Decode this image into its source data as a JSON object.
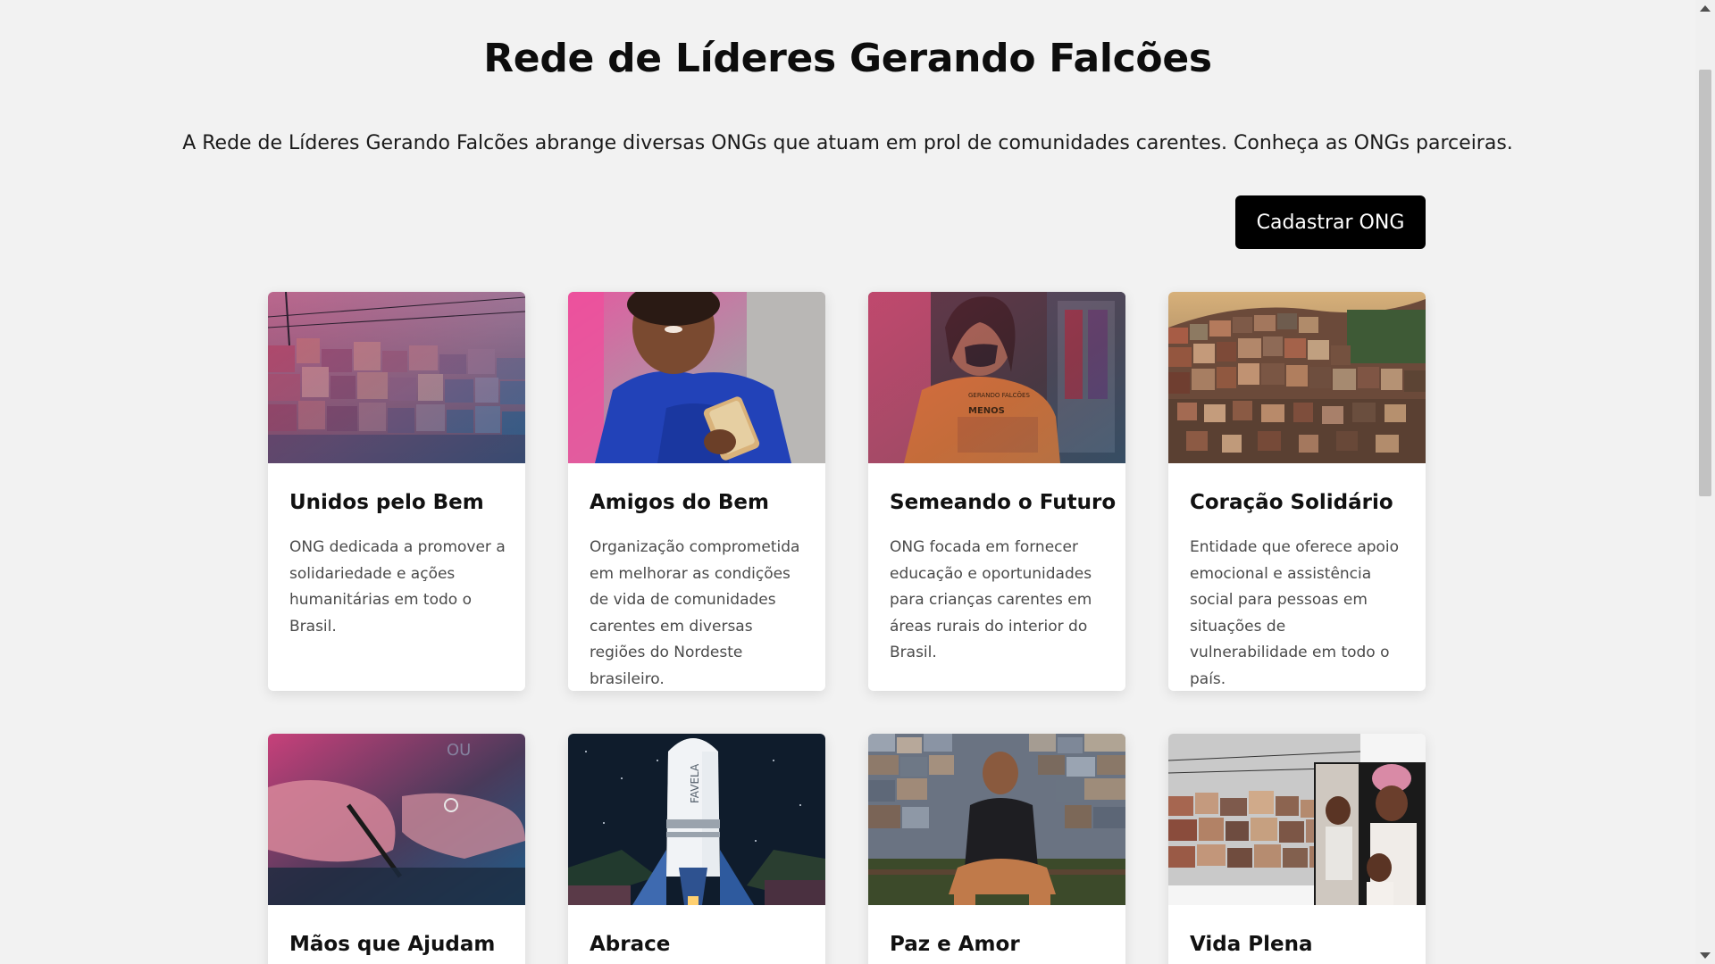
{
  "header": {
    "title": "Rede de Líderes Gerando Falcões",
    "intro": "A Rede de Líderes Gerando Falcões abrange diversas ONGs que atuam em prol de comunidades carentes. Conheça as ONGs parceiras.",
    "cta_label": "Cadastrar ONG"
  },
  "cards": [
    {
      "title": "Unidos pelo Bem",
      "description": "ONG dedicada a promover a solidariedade e ações humanitárias em todo o Brasil."
    },
    {
      "title": "Amigos do Bem",
      "description": "Organização comprometida em melhorar as condições de vida de comunidades carentes em diversas regiões do Nordeste brasileiro."
    },
    {
      "title": "Semeando o Futuro",
      "description": "ONG focada em fornecer educação e oportunidades para crianças carentes em áreas rurais do interior do Brasil."
    },
    {
      "title": "Coração Solidário",
      "description": "Entidade que oferece apoio emocional e assistência social para pessoas em situações de vulnerabilidade em todo o país."
    },
    {
      "title": "Mãos que Ajudam",
      "description": ""
    },
    {
      "title": "Abrace",
      "description": ""
    },
    {
      "title": "Paz e Amor",
      "description": ""
    },
    {
      "title": "Vida Plena",
      "description": ""
    }
  ],
  "images": {
    "logo_text_orange_shirt": "GERANDO FALCÕES",
    "shirt_word": "MENOS",
    "rocket_text": "FAVELA",
    "sign_text": "OU"
  },
  "colors": {
    "background": "#f2f2f2",
    "button": "#000000",
    "button_text": "#ffffff",
    "card": "#ffffff"
  }
}
